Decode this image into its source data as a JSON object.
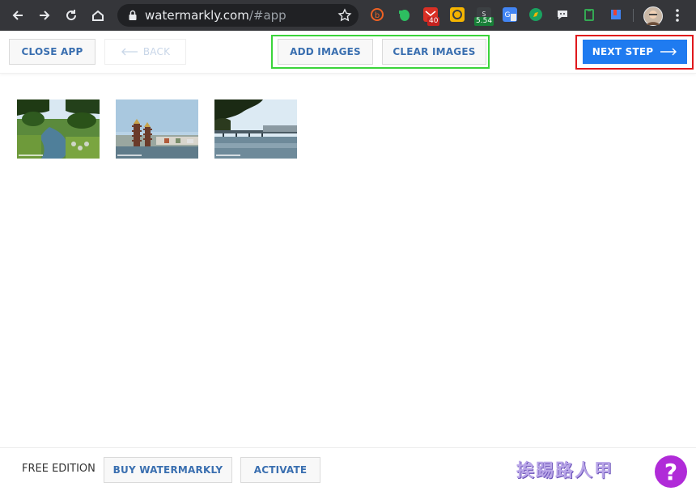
{
  "browser": {
    "url_host": "watermarkly.com",
    "url_path": "/#app",
    "extensions": [
      {
        "icon": "bitly-icon",
        "color": "#ee6123"
      },
      {
        "icon": "evernote-icon",
        "color": "#2dbe60"
      },
      {
        "icon": "gmail-checker-icon",
        "color": "#d93025",
        "badge": "40"
      },
      {
        "icon": "screenshot-icon",
        "color": "#f4b400"
      },
      {
        "icon": "timer-icon",
        "color": "#3c4043",
        "badge": "5.54"
      },
      {
        "icon": "google-translate-icon",
        "color": "#4285f4"
      },
      {
        "icon": "compass-icon",
        "color": "#1aa260"
      },
      {
        "icon": "chat-icon",
        "color": "#e8eaed"
      },
      {
        "icon": "clipboard-icon",
        "color": "#34a853"
      },
      {
        "icon": "bookmark-manager-icon",
        "color": "#4285f4"
      }
    ]
  },
  "toolbar": {
    "close_app": "CLOSE APP",
    "back": "BACK",
    "add_images": "ADD IMAGES",
    "clear_images": "CLEAR IMAGES",
    "next_step": "NEXT STEP"
  },
  "images": [
    {
      "name": "park-pond-thumbnail"
    },
    {
      "name": "pagoda-lake-thumbnail"
    },
    {
      "name": "bridge-lake-thumbnail"
    }
  ],
  "footer": {
    "edition": "FREE EDITION",
    "buy": "BUY WATERMARKLY",
    "activate": "ACTIVATE",
    "help": "?",
    "watermark_text": "挨踢路人甲"
  },
  "colors": {
    "primary": "#1f7bf0",
    "link": "#3a6fb0",
    "highlight_green": "#3ad43a",
    "highlight_red": "#e0181c",
    "help": "#b02bd8"
  }
}
